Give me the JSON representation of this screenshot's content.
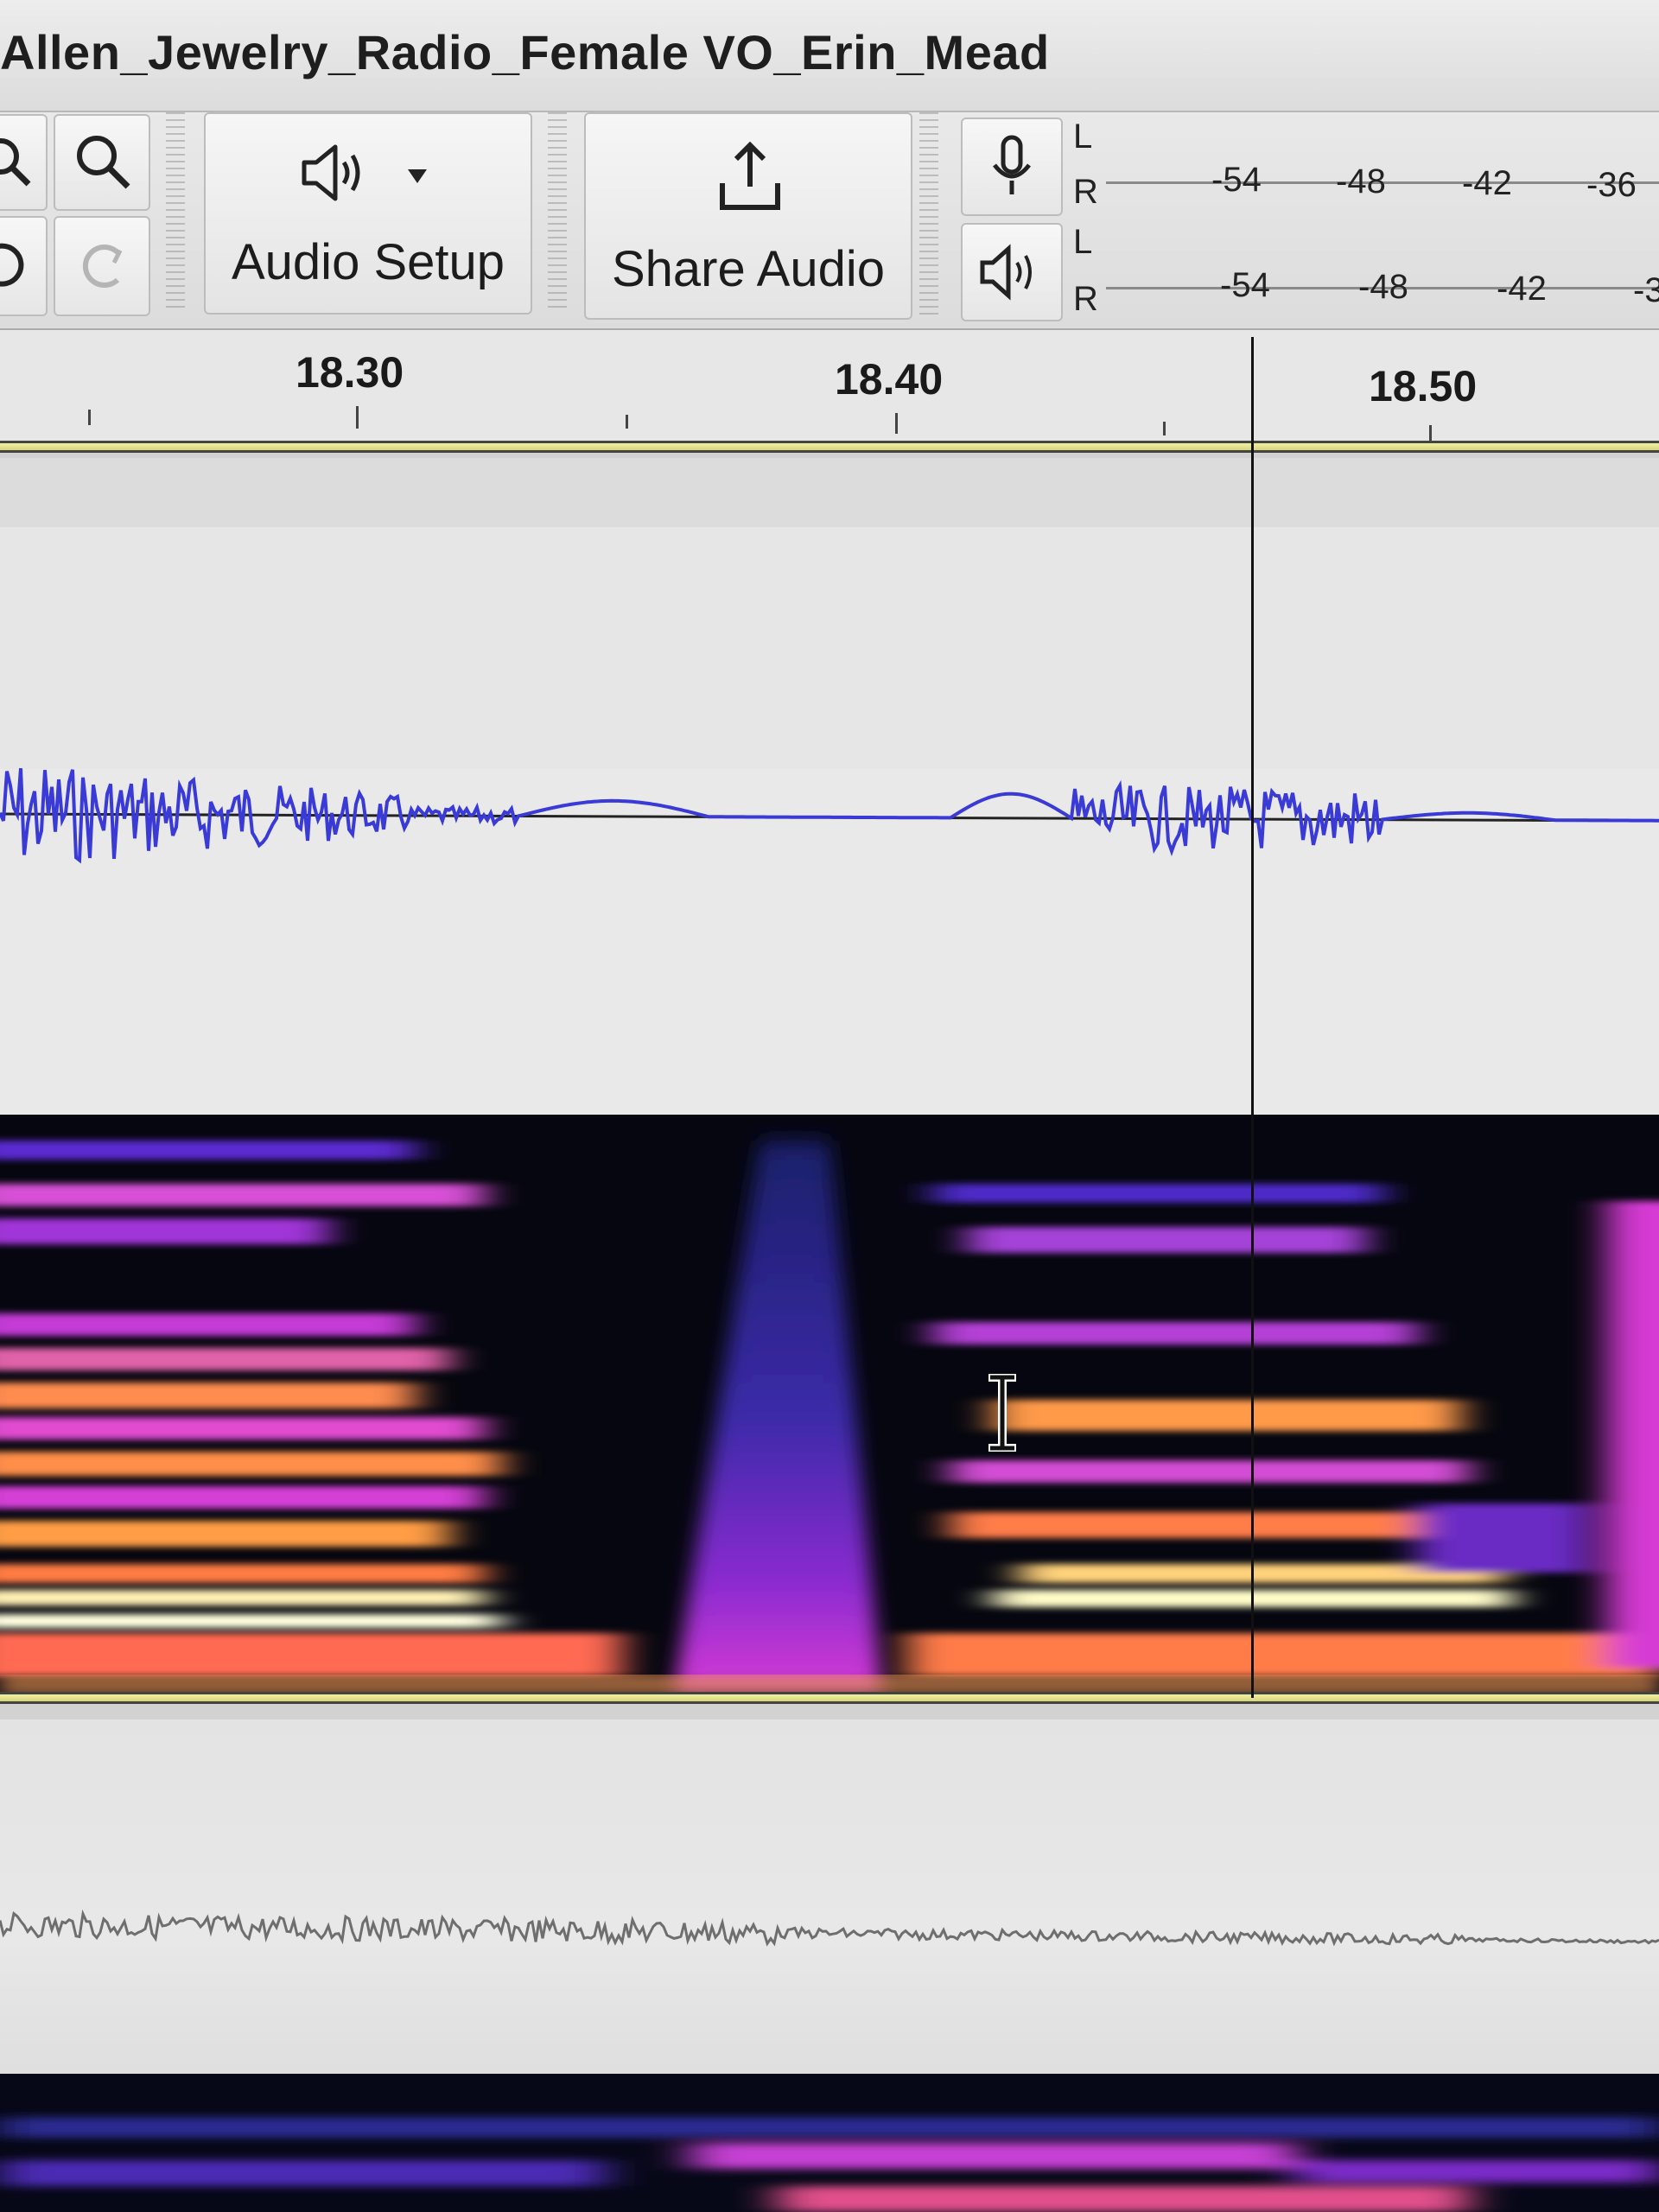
{
  "window": {
    "title": "Allen_Jewelry_Radio_Female VO_Erin_Mead"
  },
  "toolbar": {
    "audio_setup_label": "Audio Setup",
    "share_audio_label": "Share Audio",
    "zoom_icons": [
      "zoom-fit-icon",
      "zoom-in-icon"
    ],
    "history_icons": [
      "undo-icon",
      "redo-icon"
    ]
  },
  "meters": {
    "record": {
      "channels": [
        "L",
        "R"
      ],
      "ticks": [
        "-54",
        "-48",
        "-42",
        "-36"
      ]
    },
    "playback": {
      "channels": [
        "L",
        "R"
      ],
      "ticks": [
        "-54",
        "-48",
        "-42",
        "-3"
      ]
    }
  },
  "timeline": {
    "ticks": [
      "18.30",
      "18.40",
      "18.50"
    ]
  },
  "colors": {
    "waveform": "#3a3ad6",
    "track_border": "#e8e87a",
    "spectrogram_hot": "#ffcf5a",
    "spectrogram_mid": "#d13bd0"
  }
}
